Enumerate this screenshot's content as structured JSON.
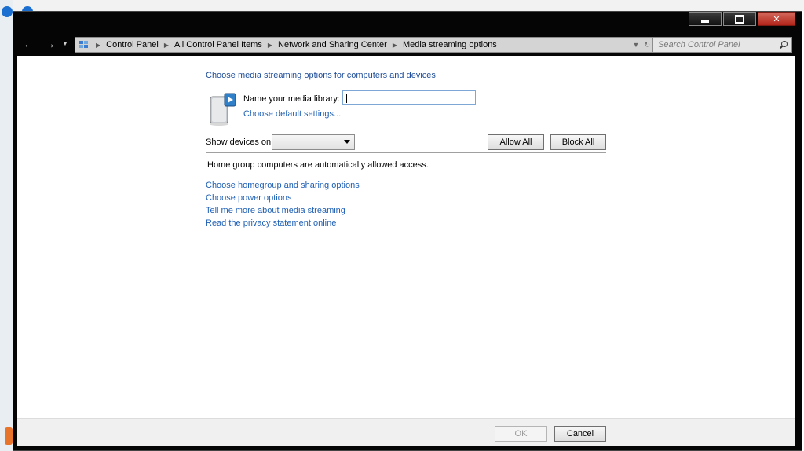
{
  "window": {
    "controls": [
      "minimize",
      "maximize",
      "close"
    ]
  },
  "nav": {
    "back_icon": "arrow-left",
    "forward_icon": "arrow-right",
    "breadcrumbs": [
      "Control Panel",
      "All Control Panel Items",
      "Network and Sharing Center",
      "Media streaming options"
    ],
    "search_placeholder": "Search Control Panel"
  },
  "main": {
    "heading": "Choose media streaming options for computers and devices",
    "library_label": "Name your media library:",
    "library_value": "",
    "default_settings_link": "Choose default settings...",
    "show_devices_label": "Show devices on:",
    "show_devices_value": "",
    "allow_all": "Allow All",
    "block_all": "Block All",
    "homegroup_note": "Home group computers are automatically allowed access.",
    "links": [
      "Choose homegroup and sharing options",
      "Choose power options",
      "Tell me more about media streaming",
      "Read the privacy statement online"
    ]
  },
  "footer": {
    "ok": "OK",
    "cancel": "Cancel"
  },
  "colors": {
    "link": "#1e5fb5",
    "heading_link": "#1e4d9b",
    "frame": "#050505"
  }
}
